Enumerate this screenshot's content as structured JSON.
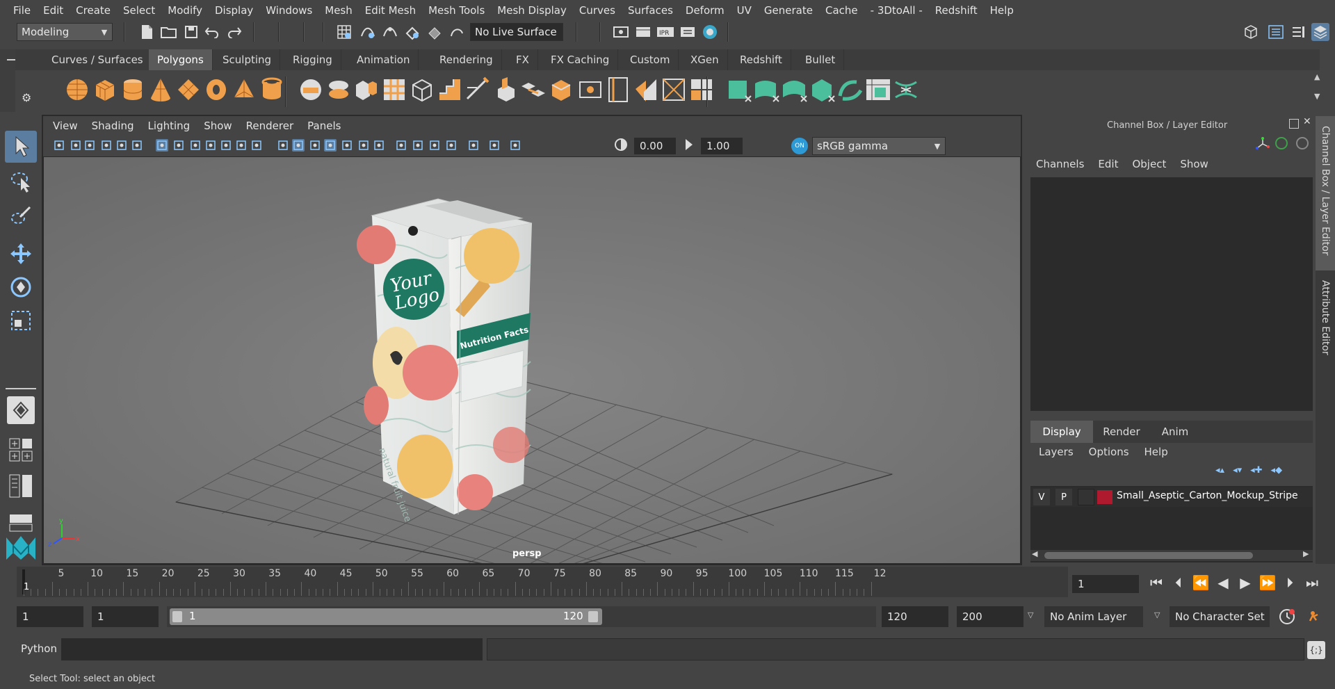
{
  "menubar": {
    "items": [
      "File",
      "Edit",
      "Create",
      "Select",
      "Modify",
      "Display",
      "Windows",
      "Mesh",
      "Edit Mesh",
      "Mesh Tools",
      "Mesh Display",
      "Curves",
      "Surfaces",
      "Deform",
      "UV",
      "Generate",
      "Cache",
      "- 3DtoAll -",
      "Redshift",
      "Help"
    ]
  },
  "statusline": {
    "workspace": "Modeling",
    "live_surface": "No Live Surface"
  },
  "shelf": {
    "tabs": [
      "Curves / Surfaces",
      "Polygons",
      "Sculpting",
      "Rigging",
      "Animation",
      "Rendering",
      "FX",
      "FX Caching",
      "Custom",
      "XGen",
      "Redshift",
      "Bullet"
    ],
    "active_tab": "Polygons"
  },
  "viewport": {
    "menus": [
      "View",
      "Shading",
      "Lighting",
      "Show",
      "Renderer",
      "Panels"
    ],
    "exposure": "0.00",
    "gamma": "1.00",
    "color_space": "sRGB gamma",
    "camera_label": "persp",
    "axis_x": "x",
    "axis_y": "y",
    "axis_z": "z",
    "logo_line1": "Your",
    "logo_line2": "Logo",
    "nutrition_label": "Nutrition Facts",
    "carton_text": "natural fruit juice"
  },
  "channelbox": {
    "title": "Channel Box / Layer Editor",
    "menus": [
      "Channels",
      "Edit",
      "Object",
      "Show"
    ],
    "layer_tabs": [
      "Display",
      "Render",
      "Anim"
    ],
    "active_layer_tab": "Display",
    "layer_menus": [
      "Layers",
      "Options",
      "Help"
    ],
    "layer": {
      "visible": "V",
      "playback": "P",
      "color": "#b01a2e",
      "name": "Small_Aseptic_Carton_Mockup_Stripe"
    }
  },
  "side_tabs": {
    "channel_box": "Channel Box / Layer Editor",
    "attribute_editor": "Attribute Editor"
  },
  "timeline": {
    "ticks": [
      "5",
      "10",
      "15",
      "20",
      "25",
      "30",
      "35",
      "40",
      "45",
      "50",
      "55",
      "60",
      "65",
      "70",
      "75",
      "80",
      "85",
      "90",
      "95",
      "100",
      "105",
      "110",
      "115",
      "12"
    ],
    "first_label": "1",
    "current_frame": "1"
  },
  "range": {
    "start_frame": "1",
    "playback_start": "1",
    "slider_start": "1",
    "slider_end": "120",
    "playback_end": "120",
    "end_frame": "200",
    "anim_layer": "No Anim Layer",
    "character_set": "No Character Set"
  },
  "commandline": {
    "language": "Python"
  },
  "helpline": {
    "text": "Select Tool: select an object"
  }
}
